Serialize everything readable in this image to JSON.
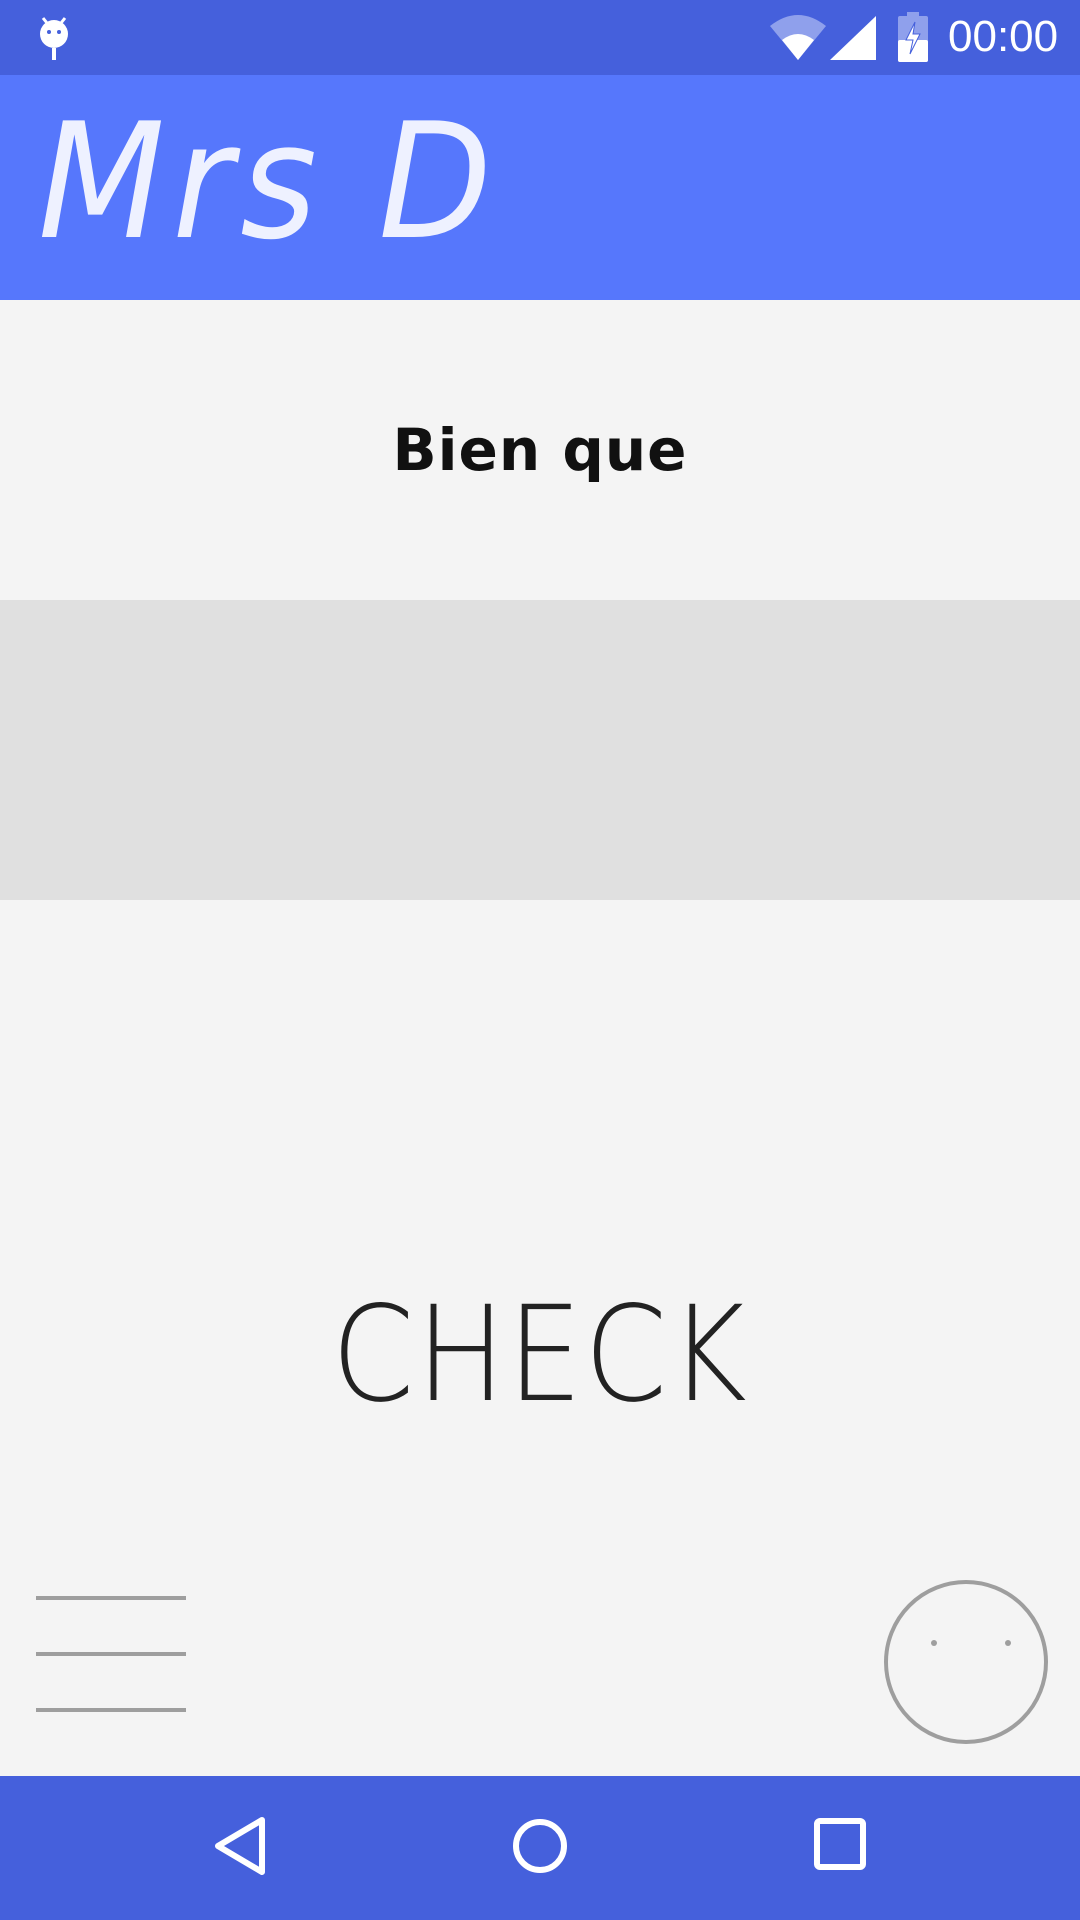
{
  "status_bar": {
    "time": "00:00",
    "icons": [
      "android-icon",
      "wifi-icon",
      "signal-icon",
      "battery-charging-icon"
    ]
  },
  "app_bar": {
    "title": "Mrs D"
  },
  "prompt": {
    "text": "Bien que"
  },
  "answer": {
    "value": ""
  },
  "actions": {
    "check_label": "CHECK"
  },
  "bottom": {
    "menu_icon": "hamburger-menu-icon",
    "face_icon": "face-icon"
  },
  "nav_bar": {
    "icons": [
      "back-icon",
      "home-icon",
      "recents-icon"
    ]
  },
  "colors": {
    "status_bar": "#4560dc",
    "app_bar": "#5677fc",
    "background": "#f4f4f4",
    "answer_area": "#e0e0e0",
    "icon_gray": "#9e9e9e"
  }
}
